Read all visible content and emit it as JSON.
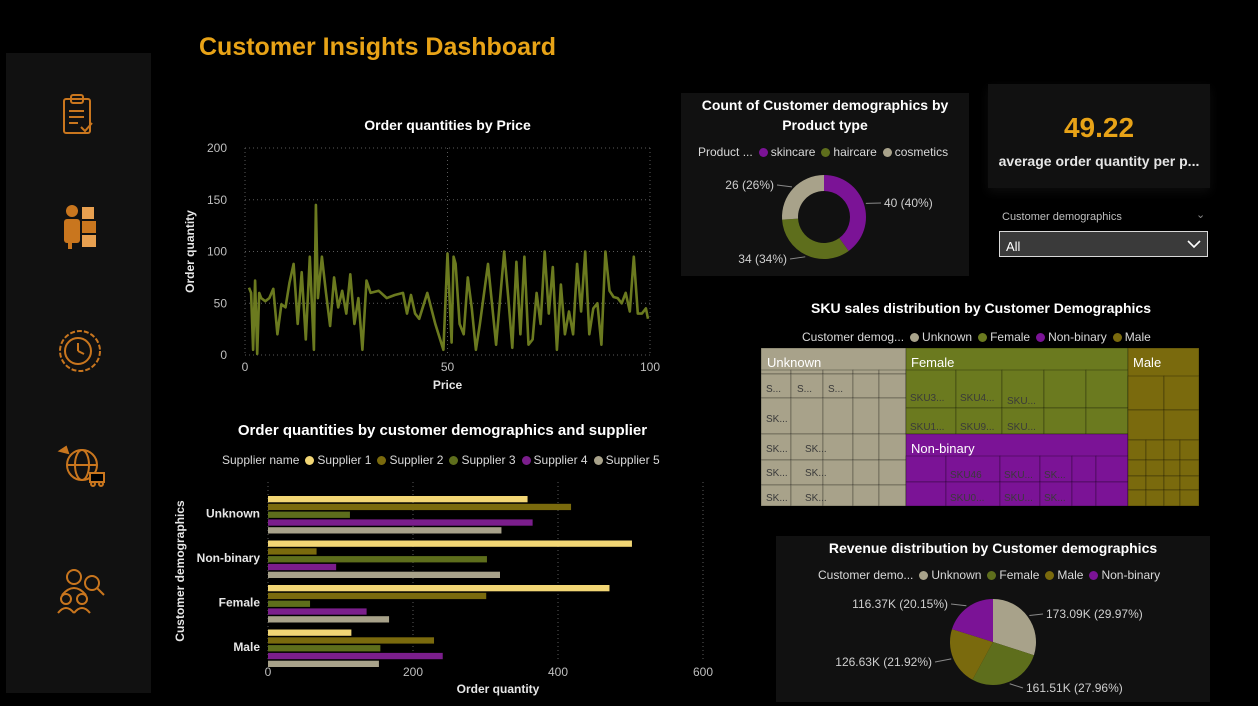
{
  "page": {
    "title": "Customer Insights Dashboard"
  },
  "sidebar": {
    "icons": [
      "clipboard-check-icon",
      "worker-boxes-icon",
      "clock-gear-icon",
      "globe-delivery-icon",
      "people-search-icon"
    ]
  },
  "colors": {
    "accent": "#E8A317",
    "line": "#6B7A1F",
    "background": "#000000",
    "card": "#111111"
  },
  "kpi": {
    "value": "49.22",
    "label": "average order quantity per p..."
  },
  "slicer": {
    "title": "Customer demographics",
    "selected": "All"
  },
  "chart_data": [
    {
      "id": "line",
      "type": "line",
      "title": "Order quantities by Price",
      "xlabel": "Price",
      "ylabel": "Order quantity",
      "xlim": [
        0,
        100
      ],
      "ylim": [
        0,
        200
      ],
      "xticks": [
        "0",
        "50",
        "100"
      ],
      "yticks": [
        "0",
        "50",
        "100",
        "150",
        "200"
      ],
      "grid": true,
      "x": [
        1,
        1.5,
        2,
        2.5,
        3,
        3.5,
        4,
        5,
        6,
        7,
        8,
        9,
        10,
        11,
        12,
        13,
        14,
        15,
        16,
        17,
        17.5,
        18,
        19,
        20,
        21,
        22,
        23,
        24,
        25,
        26,
        27,
        28,
        29,
        30,
        31,
        33,
        35,
        37,
        39,
        40,
        41,
        42,
        43,
        45,
        47,
        49,
        50,
        51,
        51.5,
        52,
        53,
        54,
        55,
        56,
        57,
        58,
        60,
        62,
        64,
        65,
        66,
        67,
        68,
        69,
        70,
        71,
        72,
        73,
        74,
        75,
        76,
        77,
        78,
        79,
        80,
        81,
        82,
        83,
        84,
        85,
        86,
        87,
        88,
        89,
        90,
        91,
        92,
        93,
        94,
        95,
        96,
        97,
        98,
        99,
        99.5
      ],
      "y": [
        65,
        60,
        5,
        72,
        1,
        60,
        55,
        52,
        55,
        64,
        20,
        49,
        46,
        70,
        88,
        30,
        80,
        15,
        95,
        5,
        145,
        55,
        95,
        60,
        28,
        75,
        46,
        62,
        40,
        78,
        30,
        55,
        5,
        72,
        60,
        62,
        55,
        58,
        60,
        40,
        58,
        40,
        35,
        60,
        30,
        5,
        98,
        12,
        95,
        88,
        30,
        20,
        75,
        45,
        5,
        30,
        88,
        10,
        100,
        55,
        7,
        90,
        20,
        95,
        10,
        15,
        60,
        30,
        100,
        40,
        85,
        5,
        68,
        20,
        42,
        20,
        88,
        42,
        100,
        20,
        45,
        50,
        10,
        100,
        62,
        56,
        55,
        50,
        60,
        42,
        95,
        40,
        40,
        45,
        35,
        10,
        78
      ],
      "series": [
        {
          "values_ref": "y"
        }
      ]
    },
    {
      "id": "hbar",
      "type": "bar",
      "orientation": "horizontal",
      "title": "Order quantities by customer demographics and supplier",
      "xlabel": "Order quantity",
      "ylabel": "Customer demographics",
      "legend_title": "Supplier name",
      "xlim": [
        0,
        600
      ],
      "xticks": [
        "0",
        "200",
        "400",
        "600"
      ],
      "categories": [
        "Unknown",
        "Non-binary",
        "Female",
        "Male"
      ],
      "series": [
        {
          "name": "Supplier 1",
          "color": "#F2D675",
          "values": [
            358,
            502,
            471,
            115
          ]
        },
        {
          "name": "Supplier 2",
          "color": "#7A6A0D",
          "values": [
            418,
            67,
            301,
            229
          ]
        },
        {
          "name": "Supplier 3",
          "color": "#5E6E1C",
          "values": [
            113,
            302,
            58,
            155
          ]
        },
        {
          "name": "Supplier 4",
          "color": "#7B1E8C",
          "values": [
            365,
            94,
            136,
            241
          ]
        },
        {
          "name": "Supplier 5",
          "color": "#A8A28A",
          "values": [
            322,
            320,
            167,
            153
          ]
        }
      ]
    },
    {
      "id": "donut",
      "type": "pie",
      "donut": true,
      "title": "Count of Customer demographics by Product type",
      "legend_title": "Product ...",
      "labels": [
        "skincare",
        "haircare",
        "cosmetics"
      ],
      "values": [
        40,
        34,
        26
      ],
      "colors": [
        "#7B1396",
        "#5E6E1C",
        "#A8A28A"
      ],
      "data_labels": [
        "40 (40%)",
        "34 (34%)",
        "26 (26%)"
      ]
    },
    {
      "id": "treemap",
      "type": "treemap",
      "title": "SKU sales distribution by Customer Demographics",
      "legend_title": "Customer demog...",
      "groups": [
        {
          "name": "Unknown",
          "color": "#A8A28A",
          "share": 0.315
        },
        {
          "name": "Female",
          "color": "#6B7A1F",
          "share": 0.3
        },
        {
          "name": "Non-binary",
          "color": "#7B1396",
          "share": 0.24
        },
        {
          "name": "Male",
          "color": "#7A6A0D",
          "share": 0.145
        }
      ],
      "cell_labels": {
        "Unknown": [
          "S...",
          "S...",
          "S...",
          "SK...",
          "SK...",
          "SK...",
          "SK...",
          "SK...",
          "SK...",
          "SK..."
        ],
        "Female": [
          "SKU3...",
          "SKU4...",
          "SKU...",
          "SKU1...",
          "SKU9...",
          "SKU..."
        ],
        "Non-binary": [
          "SKU46",
          "SKU...",
          "SK...",
          "SKU0...",
          "SKU...",
          "SK..."
        ]
      }
    },
    {
      "id": "pie",
      "type": "pie",
      "title": "Revenue distribution by Customer demographics",
      "legend_title": "Customer demo...",
      "labels": [
        "Unknown",
        "Female",
        "Male",
        "Non-binary"
      ],
      "values": [
        173.09,
        161.51,
        126.63,
        116.37
      ],
      "colors": [
        "#A8A28A",
        "#5E6E1C",
        "#7A6A0D",
        "#7B1396"
      ],
      "data_labels": [
        "173.09K (29.97%)",
        "161.51K (27.96%)",
        "126.63K (21.92%)",
        "116.37K (20.15%)"
      ]
    }
  ]
}
